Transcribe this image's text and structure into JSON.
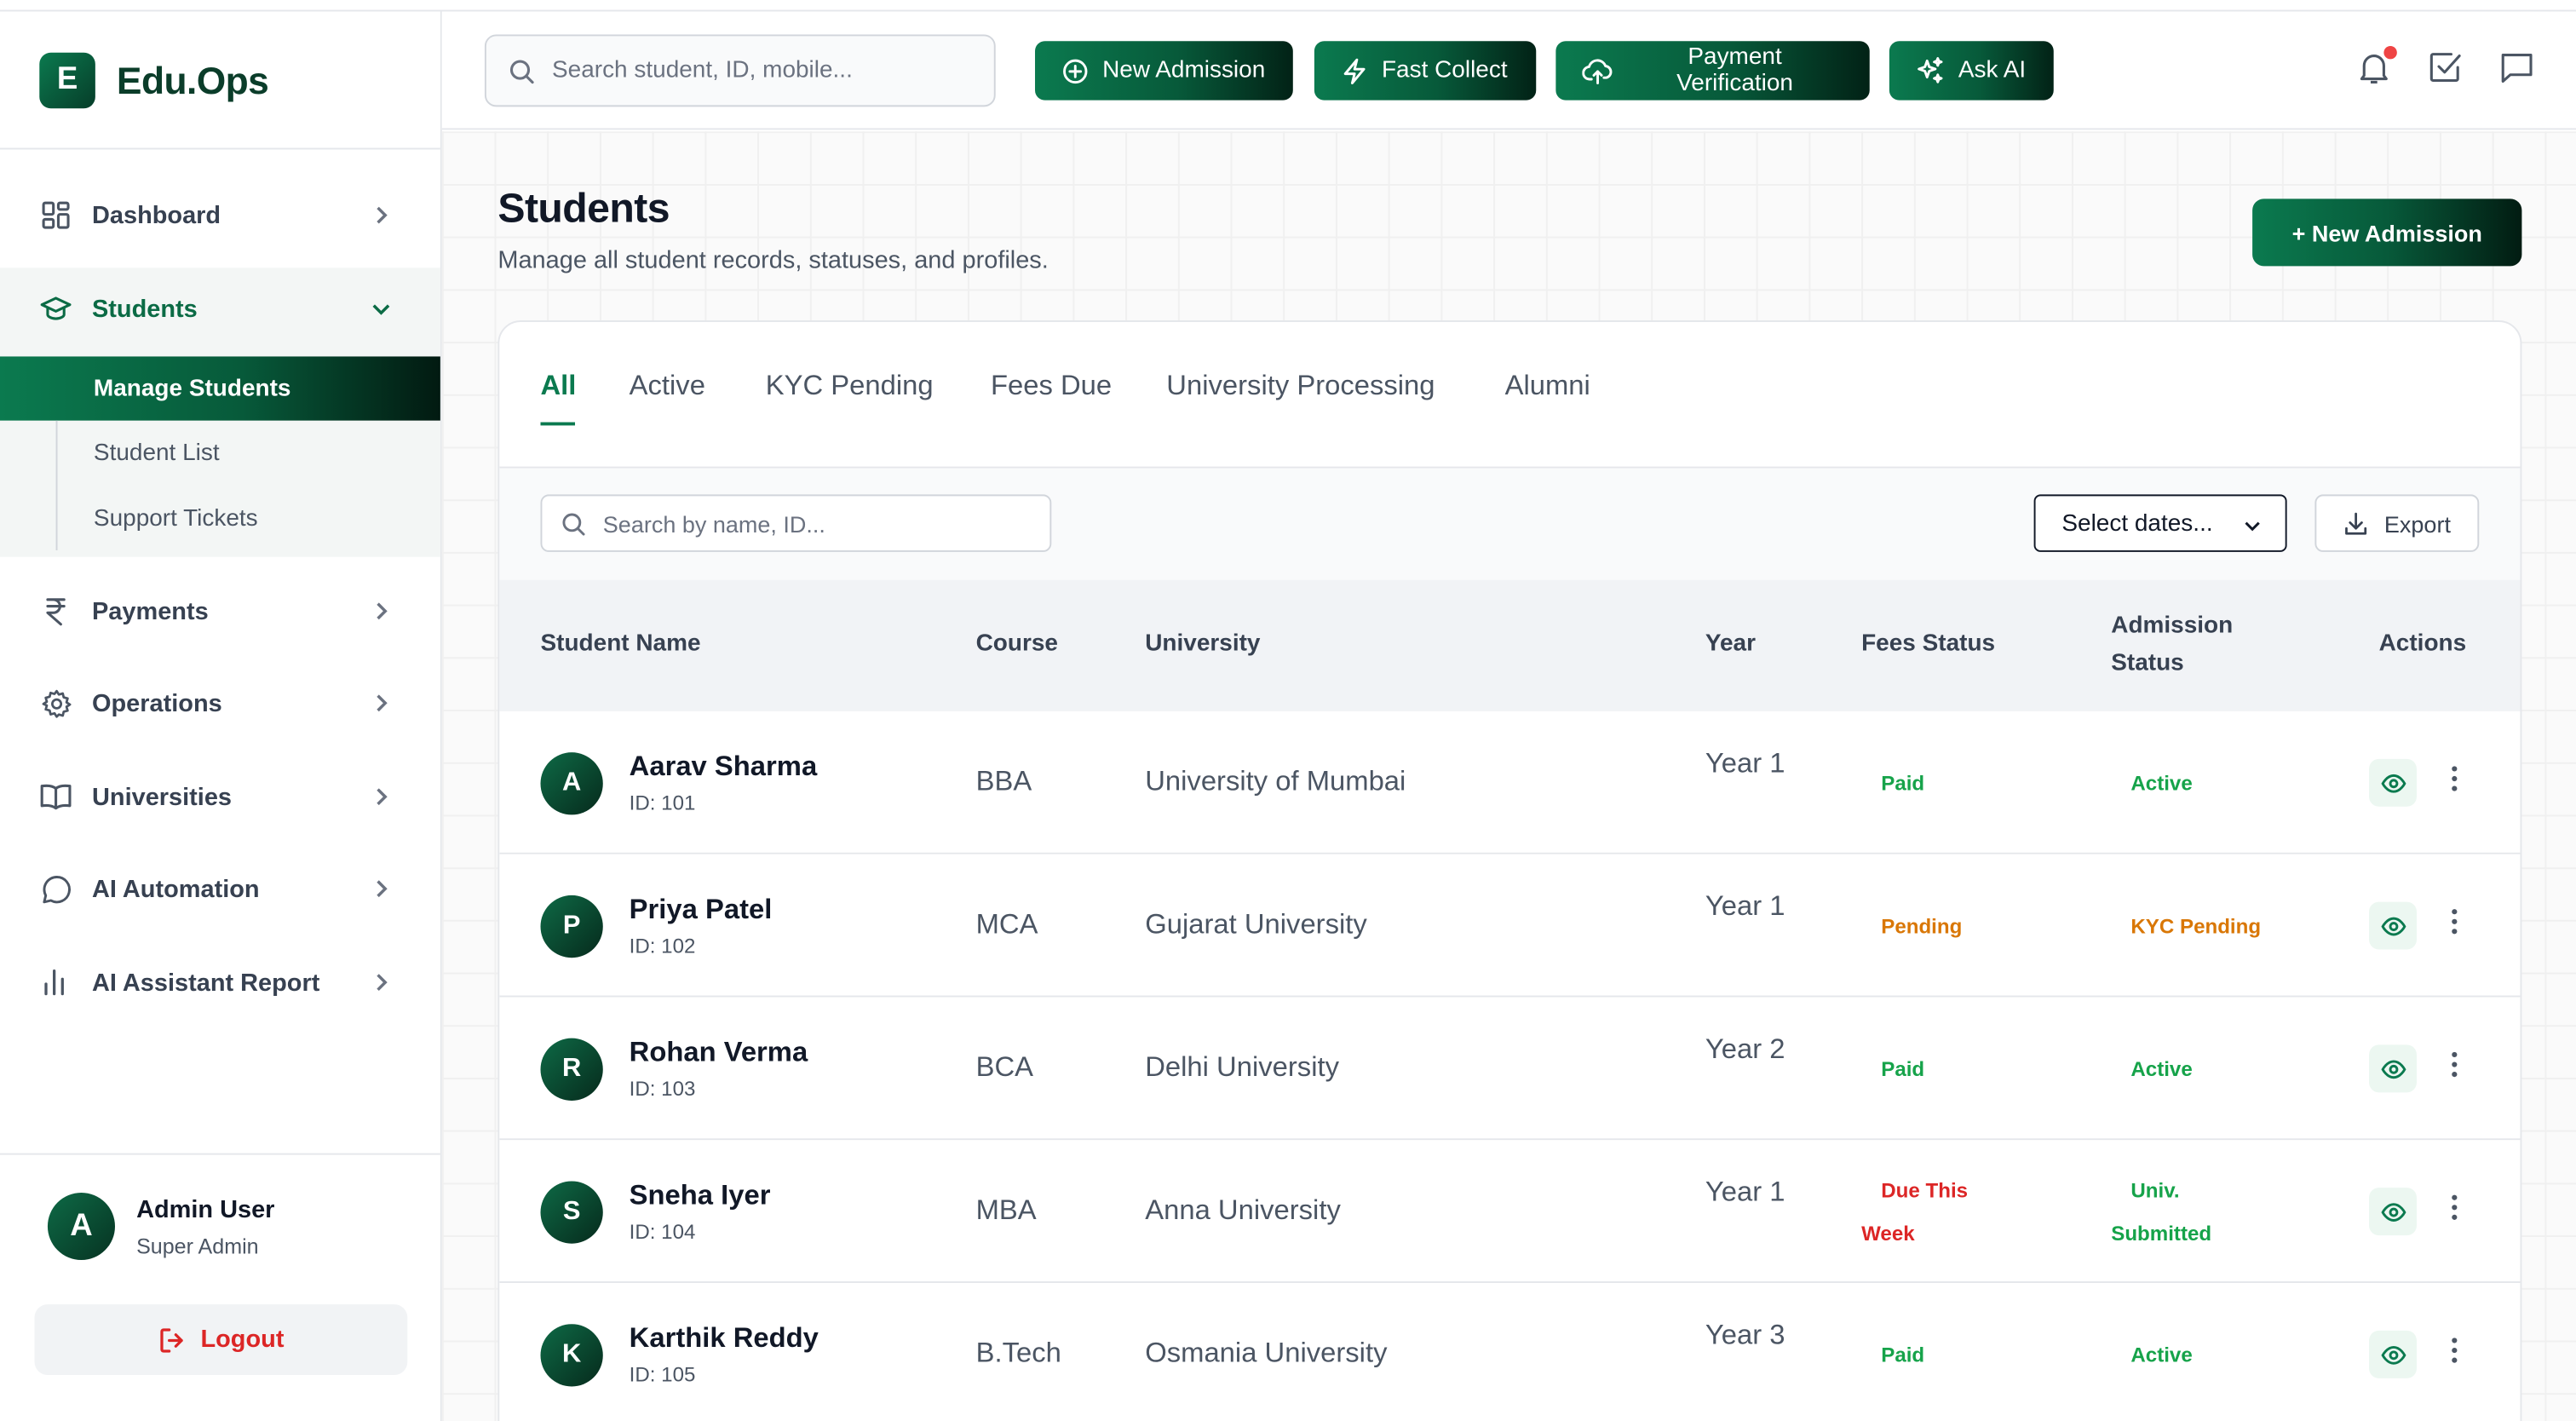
{
  "app": {
    "brand_letter": "E",
    "brand_name": "Edu.Ops",
    "accent_color": "#0b7a4f"
  },
  "sidebar": {
    "items": [
      {
        "label": "Dashboard",
        "icon": "grid-icon"
      },
      {
        "label": "Students",
        "icon": "graduation-cap-icon"
      },
      {
        "label": "Payments",
        "icon": "rupee-icon"
      },
      {
        "label": "Operations",
        "icon": "gear-icon"
      },
      {
        "label": "Universities",
        "icon": "book-icon"
      },
      {
        "label": "AI Automation",
        "icon": "chat-bubble-icon"
      },
      {
        "label": "AI Assistant Report",
        "icon": "bar-chart-icon"
      }
    ],
    "students_sub": [
      {
        "label": "Manage Students"
      },
      {
        "label": "Student List"
      },
      {
        "label": "Support Tickets"
      }
    ]
  },
  "user": {
    "initial": "A",
    "name": "Admin User",
    "role": "Super Admin",
    "logout_label": "Logout"
  },
  "topbar": {
    "search_placeholder": "Search student, ID, mobile...",
    "buttons": [
      {
        "label": "New Admission",
        "icon": "plus-circle-icon"
      },
      {
        "label": "Fast Collect",
        "icon": "lightning-icon"
      },
      {
        "label": "Payment Verification",
        "icon": "cloud-upload-icon"
      },
      {
        "label": "Ask AI",
        "icon": "sparkles-icon"
      }
    ]
  },
  "page": {
    "title": "Students",
    "subtitle": "Manage all student records, statuses, and profiles.",
    "new_admission_label": "+ New Admission"
  },
  "tabs": [
    "All",
    "Active",
    "KYC Pending",
    "Fees Due",
    "University Processing",
    "Alumni"
  ],
  "active_tab": "All",
  "filters": {
    "search_placeholder": "Search by name, ID...",
    "date_select": "Select dates...",
    "export_label": "Export"
  },
  "table": {
    "headers": {
      "name": "Student Name",
      "course": "Course",
      "university": "University",
      "year": "Year",
      "fees": "Fees Status",
      "admission": "Admission Status",
      "actions": "Actions"
    },
    "rows": [
      {
        "initial": "A",
        "name": "Aarav Sharma",
        "id": "ID: 101",
        "course": "BBA",
        "university": "University of Mumbai",
        "year": "Year 1",
        "fees": "Paid",
        "fees_color": "green",
        "admission": "Active",
        "admission_color": "green"
      },
      {
        "initial": "P",
        "name": "Priya Patel",
        "id": "ID: 102",
        "course": "MCA",
        "university": "Gujarat University",
        "year": "Year 1",
        "fees": "Pending",
        "fees_color": "amber",
        "admission": "KYC Pending",
        "admission_color": "amber"
      },
      {
        "initial": "R",
        "name": "Rohan Verma",
        "id": "ID: 103",
        "course": "BCA",
        "university": "Delhi University",
        "year": "Year 2",
        "fees": "Paid",
        "fees_color": "green",
        "admission": "Active",
        "admission_color": "green"
      },
      {
        "initial": "S",
        "name": "Sneha Iyer",
        "id": "ID: 104",
        "course": "MBA",
        "university": "Anna University",
        "year": "Year 1",
        "fees": "Due This Week",
        "fees_color": "red",
        "admission": "Univ. Submitted",
        "admission_color": "green"
      },
      {
        "initial": "K",
        "name": "Karthik Reddy",
        "id": "ID: 105",
        "course": "B.Tech",
        "university": "Osmania University",
        "year": "Year 3",
        "fees": "Paid",
        "fees_color": "green",
        "admission": "Active",
        "admission_color": "green"
      }
    ]
  }
}
